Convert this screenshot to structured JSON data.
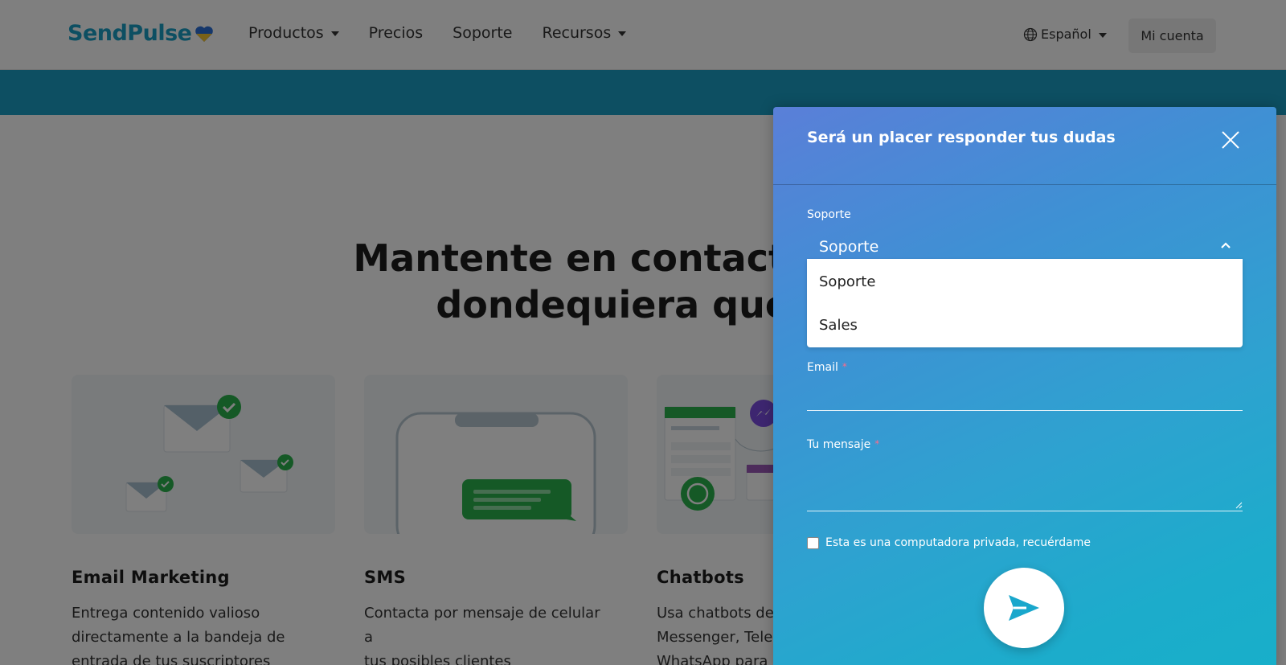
{
  "header": {
    "logo_text": "SendPulse",
    "nav": [
      {
        "label": "Productos",
        "has_dropdown": true
      },
      {
        "label": "Precios",
        "has_dropdown": false
      },
      {
        "label": "Soporte",
        "has_dropdown": false
      },
      {
        "label": "Recursos",
        "has_dropdown": true
      }
    ],
    "language": "Español",
    "account_label": "Mi cuenta"
  },
  "hero": {
    "title_line1": "Mantente en contacto con s",
    "title_line2": "dondequiera que es"
  },
  "cards": [
    {
      "title": "Email Marketing",
      "desc_lines": [
        "Entrega contenido valioso",
        "directamente a la bandeja de",
        "entrada de tus suscriptores"
      ],
      "icon": "envelopes-illustration"
    },
    {
      "title": "SMS",
      "desc_lines": [
        "Contacta por mensaje de celular a",
        "tus posibles clientes"
      ],
      "icon": "phone-sms-illustration"
    },
    {
      "title": "Chatbots",
      "desc_lines": [
        "Usa chatbots de",
        "Messenger, Tele",
        "WhatsApp para"
      ],
      "icon": "chatbots-illustration"
    }
  ],
  "widget": {
    "title": "Será un placer responder tus dudas",
    "department_label": "Soporte",
    "department_selected": "Soporte",
    "department_options": [
      "Soporte",
      "Sales"
    ],
    "email_label": "Email",
    "email_value": "",
    "message_label": "Tu mensaje",
    "message_value": "",
    "required_mark": "*",
    "remember_label": "Esta es una computadora privada, recuérdame",
    "remember_checked": false
  },
  "colors": {
    "brand": "#1b9ec4",
    "widget_gradient_start": "#5a7fd8",
    "widget_gradient_end": "#18afca",
    "required": "#ff6a8a"
  }
}
